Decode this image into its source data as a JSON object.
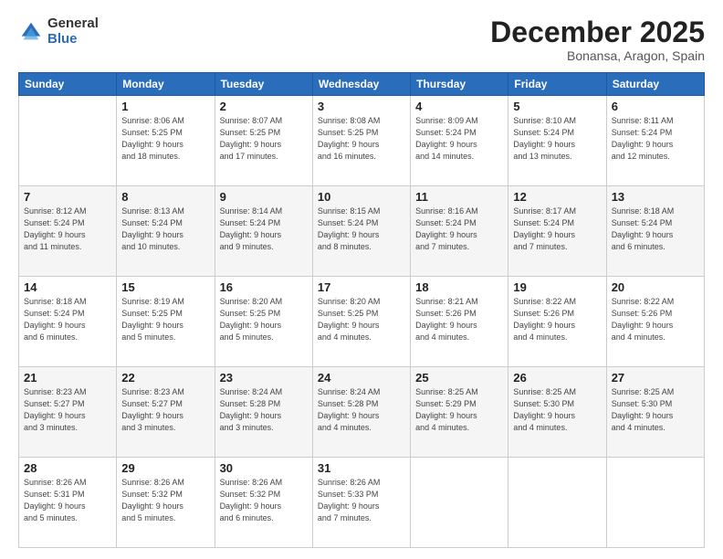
{
  "logo": {
    "general": "General",
    "blue": "Blue"
  },
  "header": {
    "month": "December 2025",
    "location": "Bonansa, Aragon, Spain"
  },
  "weekdays": [
    "Sunday",
    "Monday",
    "Tuesday",
    "Wednesday",
    "Thursday",
    "Friday",
    "Saturday"
  ],
  "weeks": [
    [
      {
        "day": "",
        "info": ""
      },
      {
        "day": "1",
        "info": "Sunrise: 8:06 AM\nSunset: 5:25 PM\nDaylight: 9 hours\nand 18 minutes."
      },
      {
        "day": "2",
        "info": "Sunrise: 8:07 AM\nSunset: 5:25 PM\nDaylight: 9 hours\nand 17 minutes."
      },
      {
        "day": "3",
        "info": "Sunrise: 8:08 AM\nSunset: 5:25 PM\nDaylight: 9 hours\nand 16 minutes."
      },
      {
        "day": "4",
        "info": "Sunrise: 8:09 AM\nSunset: 5:24 PM\nDaylight: 9 hours\nand 14 minutes."
      },
      {
        "day": "5",
        "info": "Sunrise: 8:10 AM\nSunset: 5:24 PM\nDaylight: 9 hours\nand 13 minutes."
      },
      {
        "day": "6",
        "info": "Sunrise: 8:11 AM\nSunset: 5:24 PM\nDaylight: 9 hours\nand 12 minutes."
      }
    ],
    [
      {
        "day": "7",
        "info": "Sunrise: 8:12 AM\nSunset: 5:24 PM\nDaylight: 9 hours\nand 11 minutes."
      },
      {
        "day": "8",
        "info": "Sunrise: 8:13 AM\nSunset: 5:24 PM\nDaylight: 9 hours\nand 10 minutes."
      },
      {
        "day": "9",
        "info": "Sunrise: 8:14 AM\nSunset: 5:24 PM\nDaylight: 9 hours\nand 9 minutes."
      },
      {
        "day": "10",
        "info": "Sunrise: 8:15 AM\nSunset: 5:24 PM\nDaylight: 9 hours\nand 8 minutes."
      },
      {
        "day": "11",
        "info": "Sunrise: 8:16 AM\nSunset: 5:24 PM\nDaylight: 9 hours\nand 7 minutes."
      },
      {
        "day": "12",
        "info": "Sunrise: 8:17 AM\nSunset: 5:24 PM\nDaylight: 9 hours\nand 7 minutes."
      },
      {
        "day": "13",
        "info": "Sunrise: 8:18 AM\nSunset: 5:24 PM\nDaylight: 9 hours\nand 6 minutes."
      }
    ],
    [
      {
        "day": "14",
        "info": "Sunrise: 8:18 AM\nSunset: 5:24 PM\nDaylight: 9 hours\nand 6 minutes."
      },
      {
        "day": "15",
        "info": "Sunrise: 8:19 AM\nSunset: 5:25 PM\nDaylight: 9 hours\nand 5 minutes."
      },
      {
        "day": "16",
        "info": "Sunrise: 8:20 AM\nSunset: 5:25 PM\nDaylight: 9 hours\nand 5 minutes."
      },
      {
        "day": "17",
        "info": "Sunrise: 8:20 AM\nSunset: 5:25 PM\nDaylight: 9 hours\nand 4 minutes."
      },
      {
        "day": "18",
        "info": "Sunrise: 8:21 AM\nSunset: 5:26 PM\nDaylight: 9 hours\nand 4 minutes."
      },
      {
        "day": "19",
        "info": "Sunrise: 8:22 AM\nSunset: 5:26 PM\nDaylight: 9 hours\nand 4 minutes."
      },
      {
        "day": "20",
        "info": "Sunrise: 8:22 AM\nSunset: 5:26 PM\nDaylight: 9 hours\nand 4 minutes."
      }
    ],
    [
      {
        "day": "21",
        "info": "Sunrise: 8:23 AM\nSunset: 5:27 PM\nDaylight: 9 hours\nand 3 minutes."
      },
      {
        "day": "22",
        "info": "Sunrise: 8:23 AM\nSunset: 5:27 PM\nDaylight: 9 hours\nand 3 minutes."
      },
      {
        "day": "23",
        "info": "Sunrise: 8:24 AM\nSunset: 5:28 PM\nDaylight: 9 hours\nand 3 minutes."
      },
      {
        "day": "24",
        "info": "Sunrise: 8:24 AM\nSunset: 5:28 PM\nDaylight: 9 hours\nand 4 minutes."
      },
      {
        "day": "25",
        "info": "Sunrise: 8:25 AM\nSunset: 5:29 PM\nDaylight: 9 hours\nand 4 minutes."
      },
      {
        "day": "26",
        "info": "Sunrise: 8:25 AM\nSunset: 5:30 PM\nDaylight: 9 hours\nand 4 minutes."
      },
      {
        "day": "27",
        "info": "Sunrise: 8:25 AM\nSunset: 5:30 PM\nDaylight: 9 hours\nand 4 minutes."
      }
    ],
    [
      {
        "day": "28",
        "info": "Sunrise: 8:26 AM\nSunset: 5:31 PM\nDaylight: 9 hours\nand 5 minutes."
      },
      {
        "day": "29",
        "info": "Sunrise: 8:26 AM\nSunset: 5:32 PM\nDaylight: 9 hours\nand 5 minutes."
      },
      {
        "day": "30",
        "info": "Sunrise: 8:26 AM\nSunset: 5:32 PM\nDaylight: 9 hours\nand 6 minutes."
      },
      {
        "day": "31",
        "info": "Sunrise: 8:26 AM\nSunset: 5:33 PM\nDaylight: 9 hours\nand 7 minutes."
      },
      {
        "day": "",
        "info": ""
      },
      {
        "day": "",
        "info": ""
      },
      {
        "day": "",
        "info": ""
      }
    ]
  ]
}
